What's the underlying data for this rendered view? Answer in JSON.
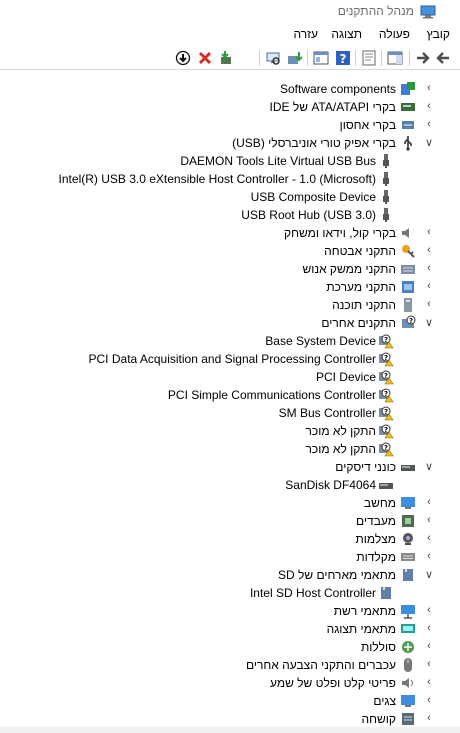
{
  "window": {
    "title": "מנהל ההתקנים"
  },
  "menu": [
    "קובץ",
    "פעולה",
    "תצוגה",
    "עזרה"
  ],
  "tree": [
    {
      "label": "Software components",
      "level": 0,
      "state": "collapsed",
      "icon": "software-components-icon"
    },
    {
      "label": "בקרי ATA/ATAPI של IDE",
      "level": 0,
      "state": "collapsed",
      "icon": "ide-controller-icon"
    },
    {
      "label": "בקרי אחסון",
      "level": 0,
      "state": "collapsed",
      "icon": "storage-controller-icon"
    },
    {
      "label": "בקרי אפיק טורי אוניברסלי (USB)",
      "level": 0,
      "state": "expanded",
      "icon": "usb-icon"
    },
    {
      "label": "DAEMON Tools Lite Virtual USB Bus",
      "level": 1,
      "icon": "usb-plug-icon"
    },
    {
      "label": "Intel(R) USB 3.0 eXtensible Host Controller - 1.0 (Microsoft)",
      "level": 1,
      "icon": "usb-plug-icon"
    },
    {
      "label": "USB Composite Device",
      "level": 1,
      "icon": "usb-plug-icon"
    },
    {
      "label": "USB Root Hub (USB 3.0)",
      "level": 1,
      "icon": "usb-plug-icon"
    },
    {
      "label": "בקרי קול, וידאו ומשחק",
      "level": 0,
      "state": "collapsed",
      "icon": "speaker-icon"
    },
    {
      "label": "התקני אבטחה",
      "level": 0,
      "state": "collapsed",
      "icon": "security-key-icon"
    },
    {
      "label": "התקני ממשק אנוש",
      "level": 0,
      "state": "collapsed",
      "icon": "hid-icon"
    },
    {
      "label": "התקני מערכת",
      "level": 0,
      "state": "collapsed",
      "icon": "system-device-icon"
    },
    {
      "label": "התקני תוכנה",
      "level": 0,
      "state": "collapsed",
      "icon": "software-device-icon"
    },
    {
      "label": "התקנים אחרים",
      "level": 0,
      "state": "expanded",
      "icon": "other-devices-icon"
    },
    {
      "label": "Base System Device",
      "level": 1,
      "icon": "warning-device-icon"
    },
    {
      "label": "PCI Data Acquisition and Signal Processing Controller",
      "level": 1,
      "icon": "warning-device-icon"
    },
    {
      "label": "PCI Device",
      "level": 1,
      "icon": "warning-device-icon"
    },
    {
      "label": "PCI Simple Communications Controller",
      "level": 1,
      "icon": "warning-device-icon"
    },
    {
      "label": "SM Bus Controller",
      "level": 1,
      "icon": "warning-device-icon"
    },
    {
      "label": "התקן לא מוכר",
      "level": 1,
      "icon": "warning-device-icon"
    },
    {
      "label": "התקן לא מוכר",
      "level": 1,
      "icon": "warning-device-icon"
    },
    {
      "label": "כונני דיסקים",
      "level": 0,
      "state": "expanded",
      "icon": "disk-drive-icon"
    },
    {
      "label": "SanDisk DF4064",
      "level": 1,
      "icon": "disk-drive-icon"
    },
    {
      "label": "מחשב",
      "level": 0,
      "state": "collapsed",
      "icon": "computer-icon"
    },
    {
      "label": "מעבדים",
      "level": 0,
      "state": "collapsed",
      "icon": "processor-icon"
    },
    {
      "label": "מצלמות",
      "level": 0,
      "state": "collapsed",
      "icon": "camera-icon"
    },
    {
      "label": "מקלדות",
      "level": 0,
      "state": "collapsed",
      "icon": "keyboard-icon"
    },
    {
      "label": "מתאמי מארחים של SD",
      "level": 0,
      "state": "expanded",
      "icon": "sd-host-icon"
    },
    {
      "label": "Intel SD Host Controller",
      "level": 1,
      "icon": "sd-host-icon"
    },
    {
      "label": "מתאמי רשת",
      "level": 0,
      "state": "collapsed",
      "icon": "network-adapter-icon"
    },
    {
      "label": "מתאמי תצוגה",
      "level": 0,
      "state": "collapsed",
      "icon": "display-adapter-icon"
    },
    {
      "label": "סוללות",
      "level": 0,
      "state": "collapsed",
      "icon": "battery-icon"
    },
    {
      "label": "עכברים והתקני הצבעה אחרים",
      "level": 0,
      "state": "collapsed",
      "icon": "mouse-icon"
    },
    {
      "label": "פריטי קלט ופלט של שמע",
      "level": 0,
      "state": "collapsed",
      "icon": "audio-io-icon"
    },
    {
      "label": "צגים",
      "level": 0,
      "state": "collapsed",
      "icon": "monitor-icon"
    },
    {
      "label": "קושחה",
      "level": 0,
      "state": "collapsed",
      "icon": "firmware-icon"
    }
  ]
}
